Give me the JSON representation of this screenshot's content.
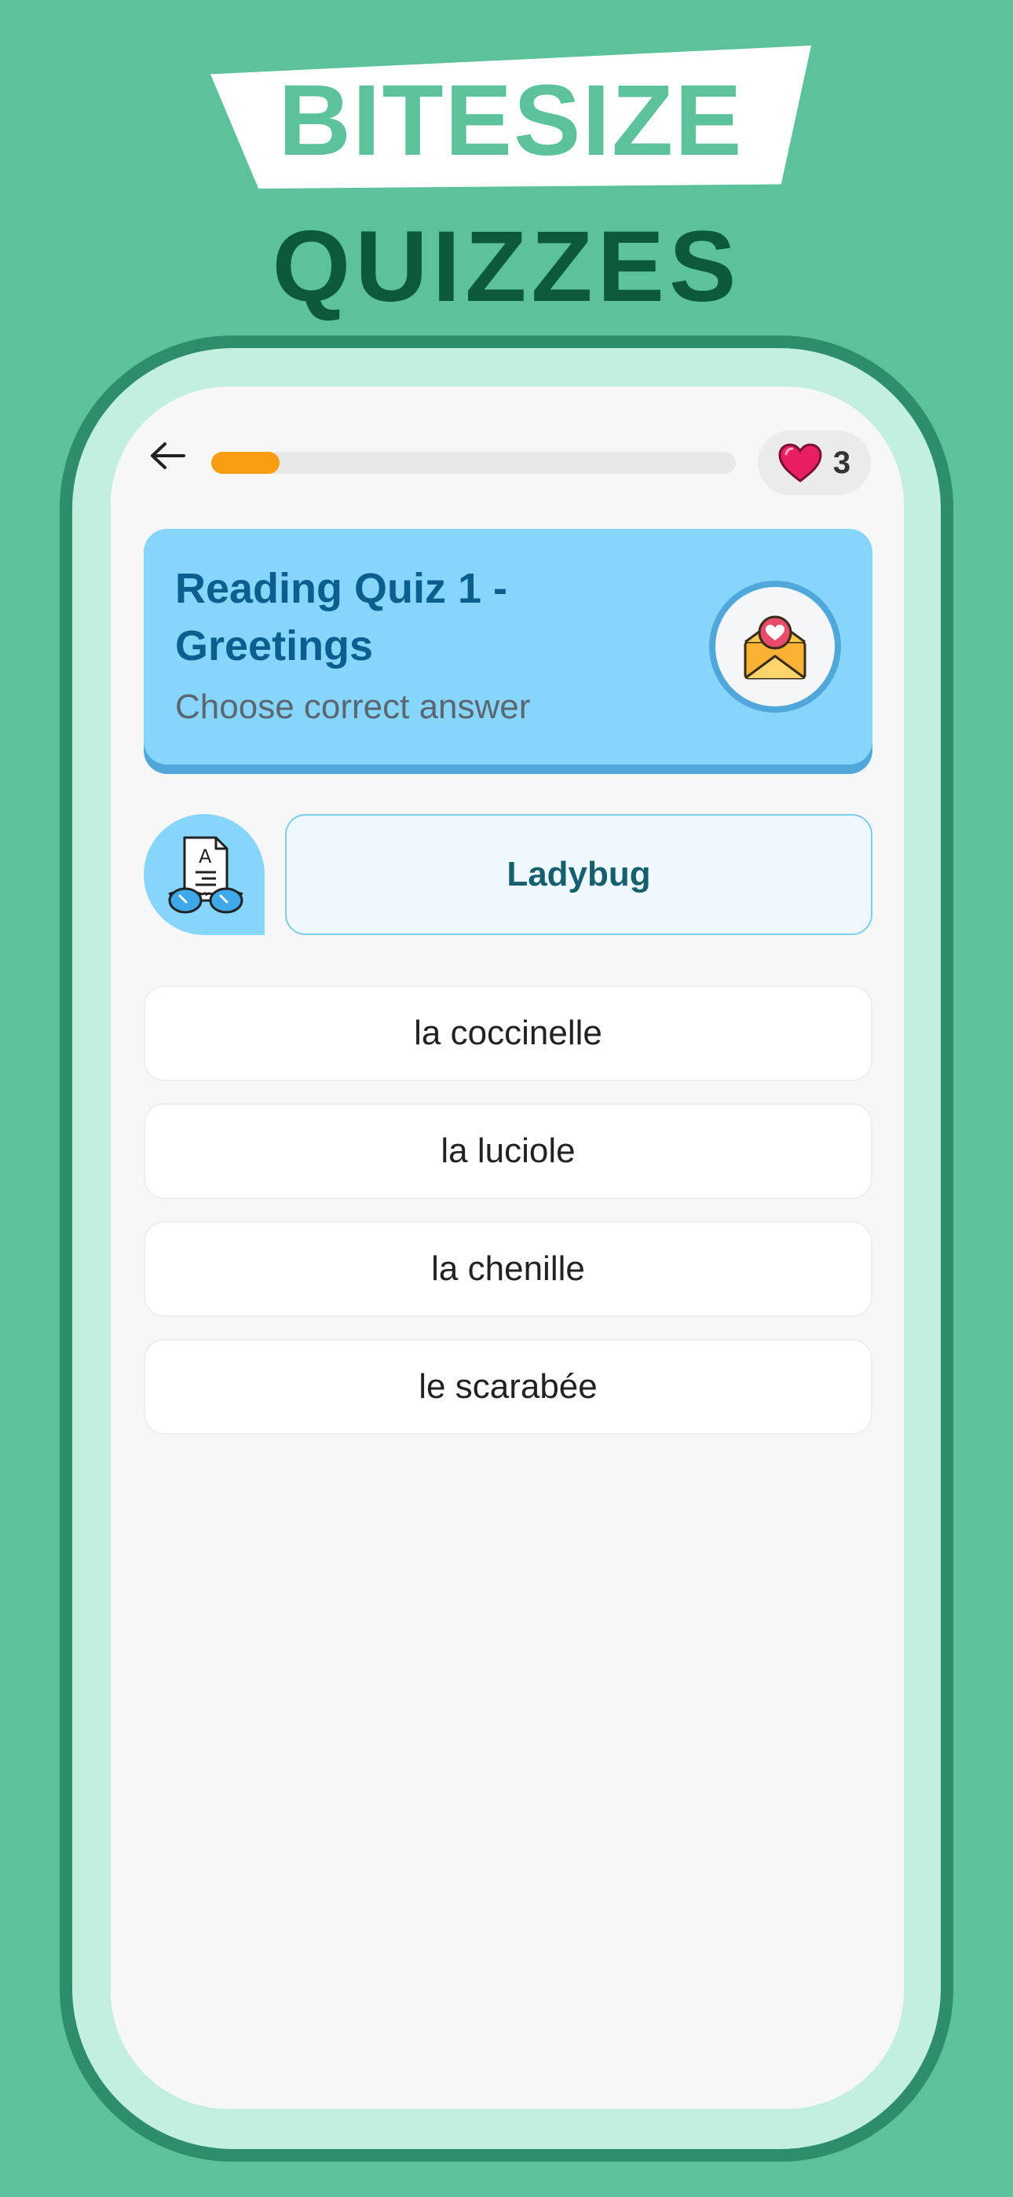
{
  "promo": {
    "headline": "BITESIZE",
    "subheadline": "QUIZZES"
  },
  "colors": {
    "background": "#5BC29C",
    "progress": "#F89C12",
    "card": "#86D6FB",
    "title": "#0B5F8E"
  },
  "topbar": {
    "back_icon": "arrow-left-icon",
    "progress_fraction": 0.13,
    "lives_icon": "heart-icon",
    "lives_count": "3"
  },
  "quiz": {
    "title": "Reading Quiz 1 - Greetings",
    "instruction": "Choose correct answer",
    "badge_icon": "love-letter-icon"
  },
  "prompt": {
    "avatar_icon": "reading-glasses-document-icon",
    "word": "Ladybug"
  },
  "options": [
    {
      "label": "la coccinelle"
    },
    {
      "label": "la luciole"
    },
    {
      "label": "la chenille"
    },
    {
      "label": "le scarabée"
    }
  ]
}
